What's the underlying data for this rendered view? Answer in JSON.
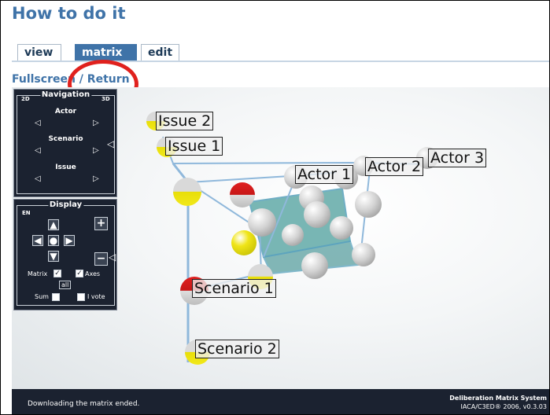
{
  "title": "How to do it",
  "tabs": [
    {
      "label": "view",
      "active": false
    },
    {
      "label": "matrix",
      "active": true
    },
    {
      "label": "edit",
      "active": false
    }
  ],
  "fullscreen_link": "Fullscreen",
  "return_link": " / Return",
  "navigation": {
    "title": "Navigation",
    "mode_left": "2D",
    "mode_right": "3D",
    "actor_label": "Actor",
    "scenario_label": "Scenario",
    "issue_label": "Issue"
  },
  "display": {
    "title": "Display",
    "lang": "EN",
    "matrix_label": "Matrix",
    "axes_label": "Axes",
    "all_label": "all",
    "sum_label": "Sum",
    "vote_label": "I vote"
  },
  "labels3d": {
    "issue2": "Issue 2",
    "issue1": "Issue 1",
    "actor1": "Actor 1",
    "actor2": "Actor 2",
    "actor3": "Actor 3",
    "scenario1": "Scenario 1",
    "scenario2": "Scenario 2"
  },
  "status": {
    "text": "Downloading the matrix ended.",
    "brand1": "Deliberation Matrix System",
    "brand2": "IACA/C3ED® 2006, v0.3.03"
  },
  "colors": {
    "header_blue": "#3f73a8",
    "panel_dark": "#1b2230",
    "red_ring": "#e0211d",
    "cube_teal": "#61a8aa"
  },
  "icons": [
    "red-ring-annotation",
    "triangle-left-icon",
    "triangle-right-icon",
    "plus-icon",
    "minus-icon",
    "arrow-up-icon",
    "arrow-down-icon",
    "arrow-left-icon",
    "arrow-right-icon",
    "center-dot-icon"
  ]
}
